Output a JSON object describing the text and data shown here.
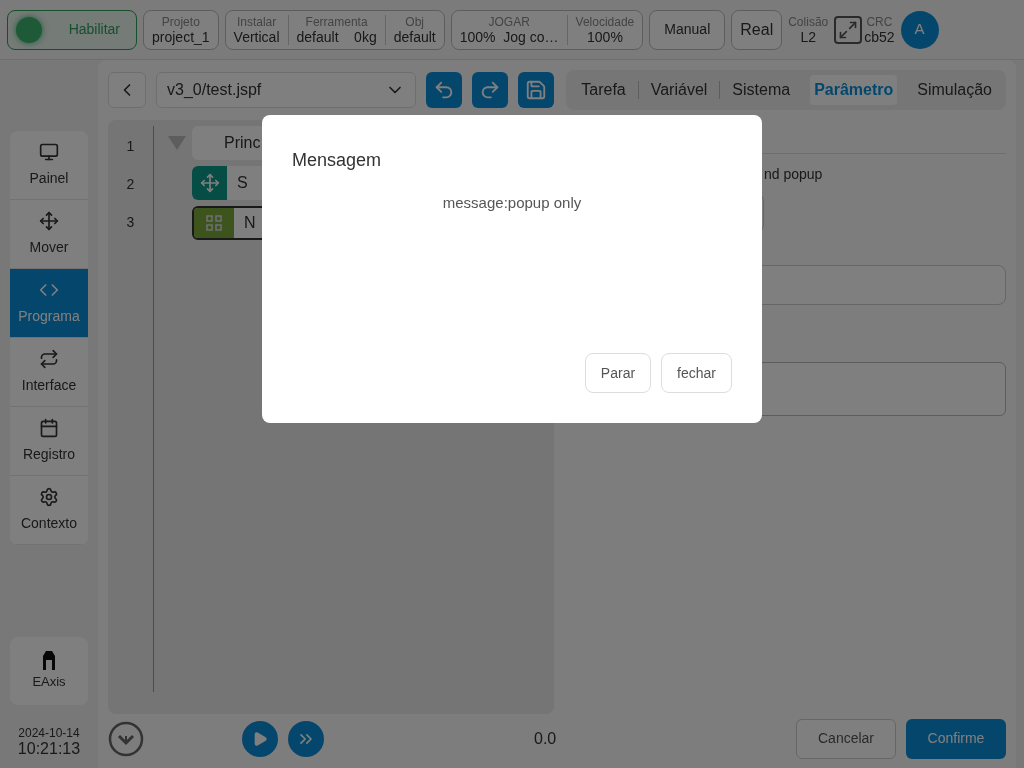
{
  "top_bar": {
    "enable_button": {
      "label": "Habilitar",
      "on": true
    },
    "groups": [
      [
        {
          "label": "Projeto",
          "value": "project_1"
        }
      ],
      [
        {
          "label": "Instalar",
          "value": "Vertical"
        },
        {
          "label": "Ferramenta",
          "value": "default    0kg"
        },
        {
          "label": "Obj",
          "value": "default"
        }
      ],
      [
        {
          "label": "JOGAR",
          "value": "100%  Jog co…"
        },
        {
          "label": "Velocidade",
          "value": "100%"
        }
      ]
    ],
    "mode_buttons": [
      "Manual",
      "Real"
    ],
    "collision": {
      "label": "Colisão",
      "value": "L2"
    },
    "crc": {
      "label": "CRC",
      "value": "cb52"
    },
    "avatar": "A"
  },
  "sidebar": {
    "items": [
      {
        "label": "Painel",
        "selected": false
      },
      {
        "label": "Mover",
        "selected": false
      },
      {
        "label": "Programa",
        "selected": true
      },
      {
        "label": "Interface",
        "selected": false
      },
      {
        "label": "Registro",
        "selected": false
      },
      {
        "label": "Contexto",
        "selected": false
      }
    ],
    "eaxis": "EAxis",
    "date": "2024-10-14",
    "time": "10:21:13"
  },
  "toolbar": {
    "file": "v3_0/test.jspf",
    "tabs": [
      {
        "label": "Tarefa",
        "selected": false
      },
      {
        "label": "Variável",
        "selected": false
      },
      {
        "label": "Sistema",
        "selected": false
      },
      {
        "label": "Parâmetro",
        "selected": true
      },
      {
        "label": "Simulação",
        "selected": false
      }
    ]
  },
  "program": {
    "lines": [
      {
        "number": "1",
        "text": "Princ",
        "kind": "root"
      },
      {
        "number": "2",
        "text": "S",
        "kind": "move"
      },
      {
        "number": "3",
        "text": "N",
        "kind": "grid"
      }
    ],
    "progress": "0.0"
  },
  "parameter_panel": {
    "label": "nd popup"
  },
  "footer_buttons": {
    "cancel": "Cancelar",
    "confirm": "Confirme"
  },
  "dialog": {
    "title": "Mensagem",
    "message": "message:popup only",
    "buttons": [
      "Parar",
      "fechar"
    ]
  }
}
